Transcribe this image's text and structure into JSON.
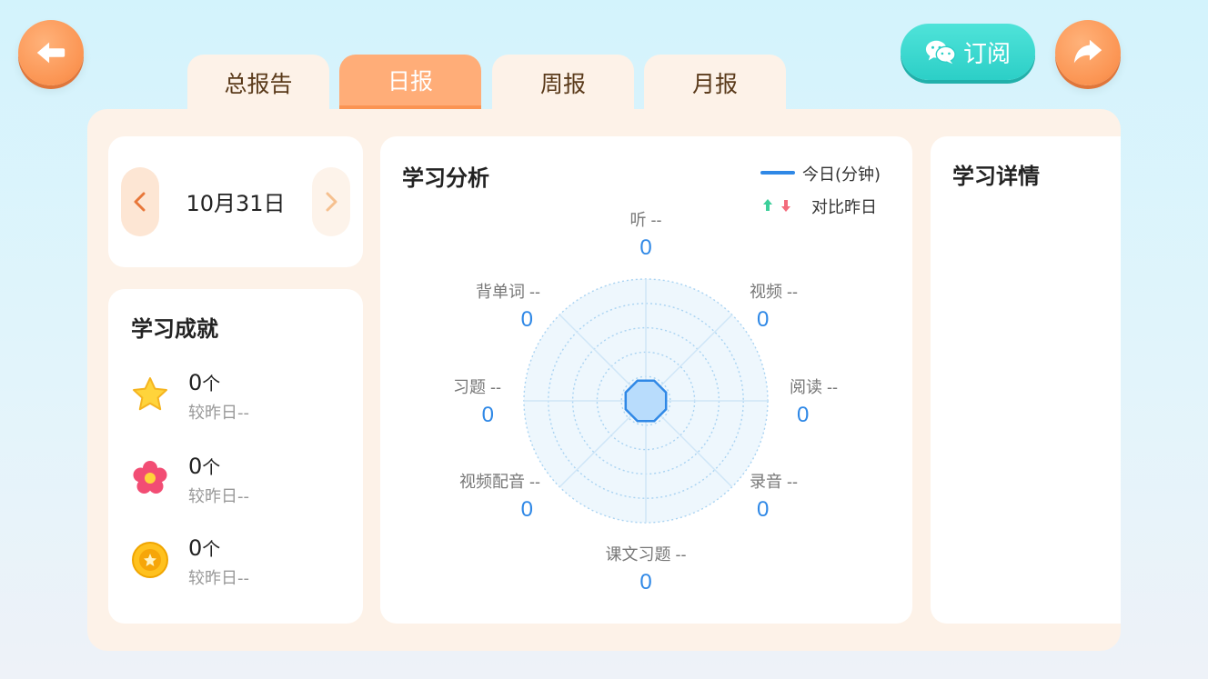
{
  "nav": {
    "back_icon": "back-arrow-icon",
    "share_icon": "share-arrow-icon",
    "accent": "#fb9452"
  },
  "subscribe": {
    "icon": "wechat-icon",
    "label": "订阅",
    "color": "#2ccfc7"
  },
  "tabs": [
    {
      "label": "总报告",
      "active": false
    },
    {
      "label": "日报",
      "active": true
    },
    {
      "label": "周报",
      "active": false
    },
    {
      "label": "月报",
      "active": false
    }
  ],
  "date": {
    "label": "10月31日",
    "prev_icon": "chevron-left-icon",
    "next_icon": "chevron-right-icon"
  },
  "achievements": {
    "title": "学习成就",
    "items": [
      {
        "icon": "star-icon",
        "count": "0",
        "unit": "个",
        "compare": "较昨日--"
      },
      {
        "icon": "flower-icon",
        "count": "0",
        "unit": "个",
        "compare": "较昨日--"
      },
      {
        "icon": "medal-icon",
        "count": "0",
        "unit": "个",
        "compare": "较昨日--"
      }
    ]
  },
  "analysis": {
    "title": "学习分析",
    "legend_today": "今日(分钟)",
    "legend_compare": "对比昨日",
    "line_color": "#2f88e6",
    "up_color": "#3ccf9a",
    "down_color": "#f36b7c"
  },
  "chart_data": {
    "type": "radar",
    "title": "学习分析",
    "legend": [
      "今日(分钟)",
      "对比昨日"
    ],
    "categories": [
      "听",
      "视频",
      "阅读",
      "录音",
      "课文习题",
      "视频配音",
      "习题",
      "背单词"
    ],
    "series": [
      {
        "name": "今日(分钟)",
        "values": [
          0,
          0,
          0,
          0,
          0,
          0,
          0,
          0
        ]
      }
    ],
    "compare": [
      "--",
      "--",
      "--",
      "--",
      "--",
      "--",
      "--",
      "--"
    ],
    "value_labels": [
      "0",
      "0",
      "0",
      "0",
      "0",
      "0",
      "0",
      "0"
    ],
    "rings": 5
  },
  "detail": {
    "title": "学习详情"
  }
}
